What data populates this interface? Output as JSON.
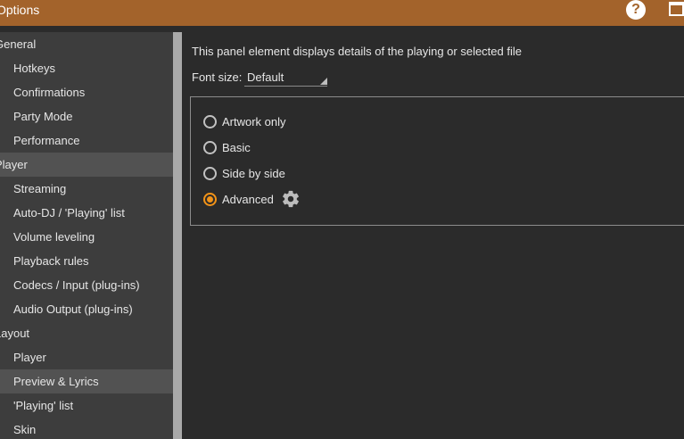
{
  "window": {
    "title": "Options"
  },
  "titlebar": {
    "help_glyph": "?"
  },
  "sidebar": {
    "items": [
      {
        "label": "General",
        "kind": "group"
      },
      {
        "label": "Hotkeys",
        "kind": "child"
      },
      {
        "label": "Confirmations",
        "kind": "child"
      },
      {
        "label": "Party Mode",
        "kind": "child"
      },
      {
        "label": "Performance",
        "kind": "child"
      },
      {
        "label": "Player",
        "kind": "group"
      },
      {
        "label": "Streaming",
        "kind": "child"
      },
      {
        "label": "Auto-DJ / 'Playing' list",
        "kind": "child"
      },
      {
        "label": "Volume leveling",
        "kind": "child"
      },
      {
        "label": "Playback rules",
        "kind": "child"
      },
      {
        "label": "Codecs / Input (plug-ins)",
        "kind": "child"
      },
      {
        "label": "Audio Output (plug-ins)",
        "kind": "child"
      },
      {
        "label": "Layout",
        "kind": "group"
      },
      {
        "label": "Player",
        "kind": "child"
      },
      {
        "label": "Preview & Lyrics",
        "kind": "child",
        "selected": true
      },
      {
        "label": "'Playing' list",
        "kind": "child"
      },
      {
        "label": "Skin",
        "kind": "child"
      }
    ]
  },
  "main": {
    "description": "This panel element displays details of the playing or selected file",
    "font_size_label": "Font size:",
    "font_size_value": "Default",
    "options": [
      {
        "label": "Artwork only",
        "checked": false
      },
      {
        "label": "Basic",
        "checked": false
      },
      {
        "label": "Side by side",
        "checked": false
      },
      {
        "label": "Advanced",
        "checked": true
      }
    ]
  },
  "colors": {
    "titlebar": "#a3632b",
    "accent": "#f29318",
    "sidebar": "#3d3d3d",
    "background": "#2b2b2b"
  },
  "icons": {
    "help": "help-icon",
    "maximize": "maximize-icon",
    "settings": "gear-icon"
  }
}
